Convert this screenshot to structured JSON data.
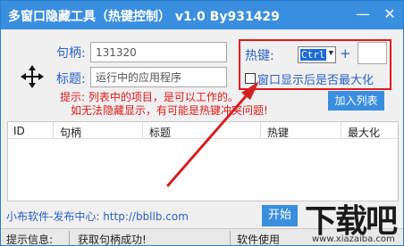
{
  "window": {
    "title": "多窗口隐藏工具（热键控制） v1.0 By931429",
    "min_glyph": "—",
    "close_glyph": "✕"
  },
  "form": {
    "handle_label": "句柄:",
    "handle_value": "131320",
    "title_label": "标题:",
    "title_value": "运行中的应用程序",
    "move_icon": "move-crosshair-icon"
  },
  "hotkey": {
    "label": "热键:",
    "selected": "Ctrl",
    "plus": "+",
    "key_value": "",
    "checkbox_label": "窗口显示后是否最大化",
    "checked": false
  },
  "hint": {
    "line1": "提示: 列表中的项目，是可以工作的。",
    "line2": "如无法隐藏显示，有可能是热键冲突问题!"
  },
  "buttons": {
    "add_list": "加入列表",
    "start": "开始"
  },
  "table": {
    "columns": [
      "ID",
      "句柄",
      "标题",
      "热键",
      "最大化"
    ],
    "rows": []
  },
  "footer": {
    "publisher": "小布软件-发布中心: http://bbllb.com"
  },
  "status": {
    "label": "提示信息:",
    "message": "获取句柄成功!",
    "right": "软件使用"
  },
  "watermark": {
    "big": "下载吧",
    "small": "www.xiazaiba.com"
  },
  "colors": {
    "titlebar": "#3a8ee0",
    "label_blue": "#2b62c8",
    "highlight_red": "#e01919",
    "button_blue": "#3a8ee0"
  }
}
